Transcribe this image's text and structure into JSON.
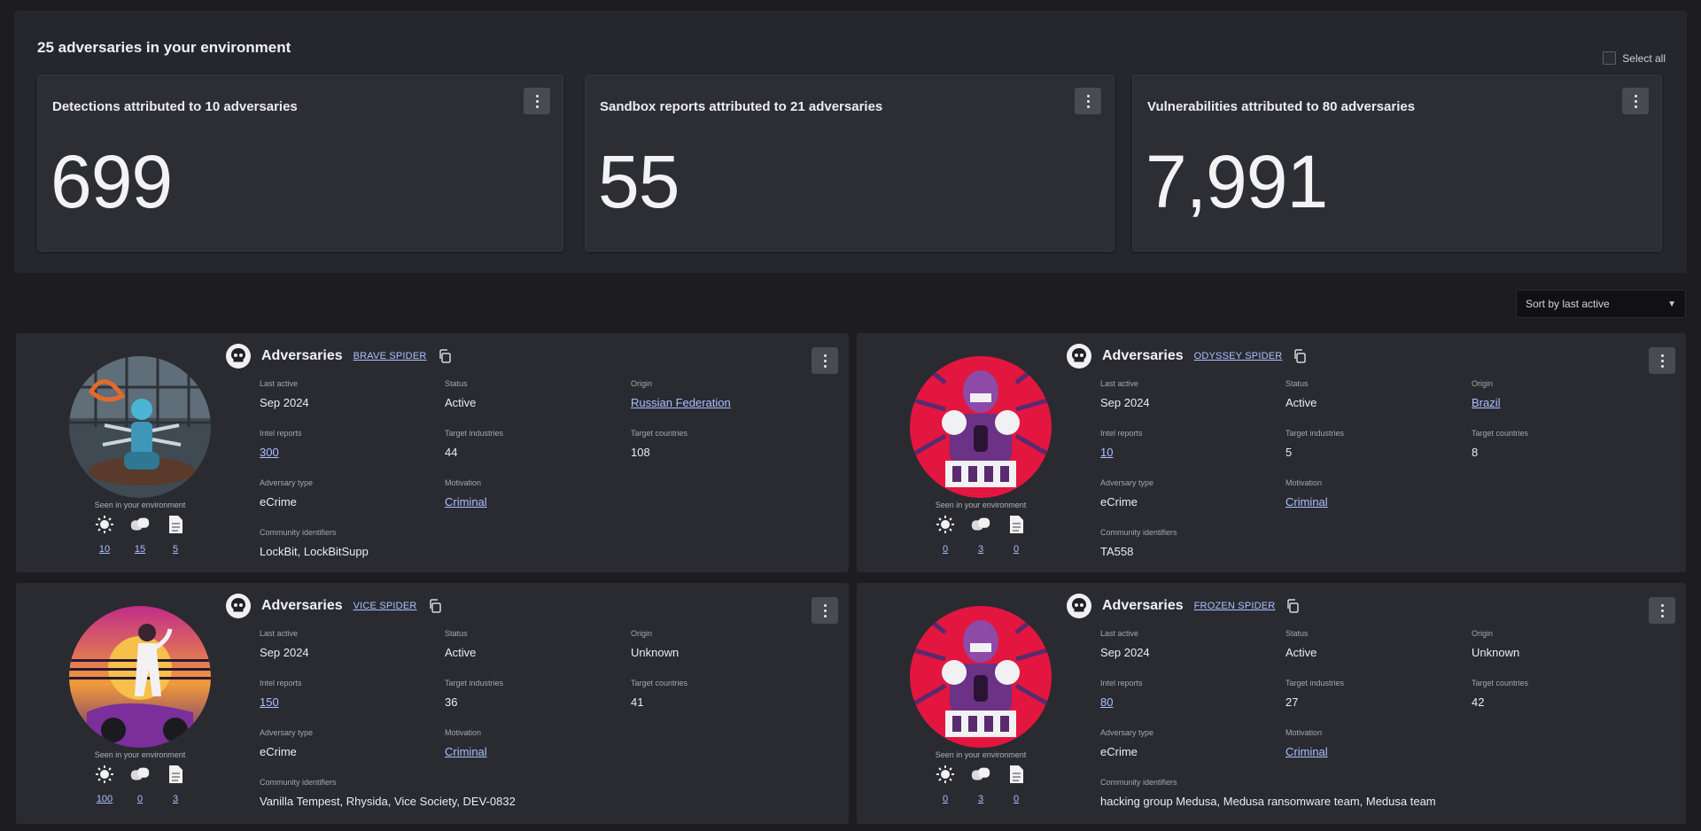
{
  "summary": {
    "title": "25 adversaries in your environment",
    "select_all": "Select all",
    "stats": [
      {
        "label": "Detections attributed to 10 adversaries",
        "value": "699"
      },
      {
        "label": "Sandbox reports attributed to 21 adversaries",
        "value": "55"
      },
      {
        "label": "Vulnerabilities attributed to 80 adversaries",
        "value": "7,991"
      }
    ]
  },
  "sort": {
    "label": "Sort by last active"
  },
  "labels": {
    "kind": "Adversaries",
    "last_active": "Last active",
    "status": "Status",
    "origin": "Origin",
    "intel_reports": "Intel reports",
    "target_industries": "Target industries",
    "target_countries": "Target countries",
    "adversary_type": "Adversary type",
    "motivation": "Motivation",
    "community_identifiers": "Community identifiers",
    "seen": "Seen in your environment"
  },
  "adversaries": [
    {
      "name": "BRAVE SPIDER",
      "last_active": "Sep 2024",
      "status": "Active",
      "origin": "Russian Federation",
      "intel_reports": "300",
      "target_industries": "44",
      "target_countries": "108",
      "adversary_type": "eCrime",
      "motivation": "Criminal",
      "community_identifiers": "LockBit, LockBitSupp",
      "seen_counts": [
        "10",
        "15",
        "5"
      ]
    },
    {
      "name": "ODYSSEY SPIDER",
      "last_active": "Sep 2024",
      "status": "Active",
      "origin": "Brazil",
      "intel_reports": "10",
      "target_industries": "5",
      "target_countries": "8",
      "adversary_type": "eCrime",
      "motivation": "Criminal",
      "community_identifiers": "TA558",
      "seen_counts": [
        "0",
        "3",
        "0"
      ]
    },
    {
      "name": "VICE SPIDER",
      "last_active": "Sep 2024",
      "status": "Active",
      "origin": "Unknown",
      "intel_reports": "150",
      "target_industries": "36",
      "target_countries": "41",
      "adversary_type": "eCrime",
      "motivation": "Criminal",
      "community_identifiers": "Vanilla Tempest, Rhysida, Vice Society, DEV-0832",
      "seen_counts": [
        "100",
        "0",
        "3"
      ]
    },
    {
      "name": "FROZEN SPIDER",
      "last_active": "Sep 2024",
      "status": "Active",
      "origin": "Unknown",
      "intel_reports": "80",
      "target_industries": "27",
      "target_countries": "42",
      "adversary_type": "eCrime",
      "motivation": "Criminal",
      "community_identifiers": "hacking group Medusa, Medusa ransomware team, Medusa team",
      "seen_counts": [
        "0",
        "3",
        "0"
      ]
    }
  ],
  "colors": {
    "page_bg": "#1c1c21",
    "panel_bg": "#26262d",
    "card_bg": "#2a2a31",
    "link": "#a9c1ff"
  },
  "icons": [
    "kebab-menu-icon",
    "skull-icon",
    "copy-icon",
    "sun-icon",
    "pill-icon",
    "document-icon",
    "chevron-down-icon"
  ]
}
